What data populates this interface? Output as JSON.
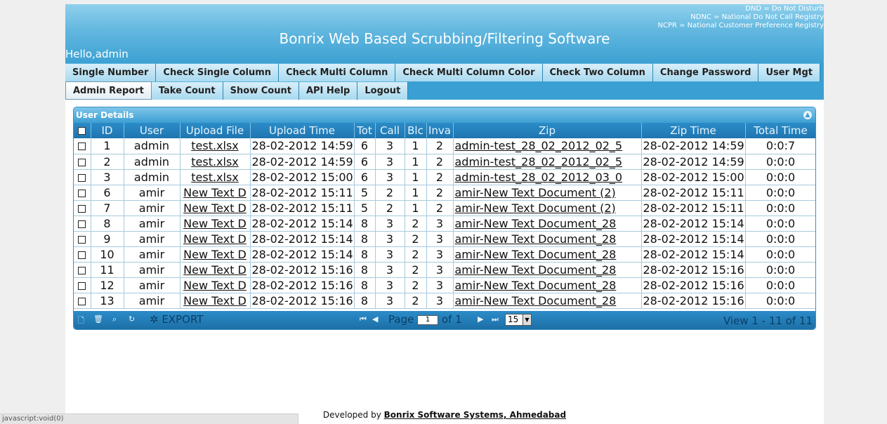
{
  "header": {
    "legend": [
      "DND = Do Not Disturb",
      "NDNC = National Do Not Call Registry",
      "NCPR = National Customer Preference Registry"
    ],
    "title": "Bonrix Web Based Scrubbing/Filtering Software",
    "greeting": "Hello,admin"
  },
  "nav": {
    "row1": [
      "Single Number",
      "Check Single Column",
      "Check Multi Column",
      "Check Multi Column Color",
      "Check Two Column",
      "Change Password",
      "User Mgt"
    ],
    "row2": [
      "Admin Report",
      "Take Count",
      "Show Count",
      "API Help",
      "Logout"
    ]
  },
  "grid": {
    "caption": "User Details",
    "columns": [
      "ID",
      "User",
      "Upload File",
      "Upload Time",
      "Tot",
      "Call",
      "Blc",
      "Inva",
      "Zip",
      "Zip Time",
      "Total Time"
    ],
    "rows": [
      [
        "1",
        "admin",
        "test.xlsx",
        "28-02-2012 14:59",
        "6",
        "3",
        "1",
        "2",
        "admin-test_28_02_2012_02_5",
        "28-02-2012 14:59",
        "0:0:7"
      ],
      [
        "2",
        "admin",
        "test.xlsx",
        "28-02-2012 14:59",
        "6",
        "3",
        "1",
        "2",
        "admin-test_28_02_2012_02_5",
        "28-02-2012 14:59",
        "0:0:0"
      ],
      [
        "3",
        "admin",
        "test.xlsx",
        "28-02-2012 15:00",
        "6",
        "3",
        "1",
        "2",
        "admin-test_28_02_2012_03_0",
        "28-02-2012 15:00",
        "0:0:0"
      ],
      [
        "6",
        "amir",
        "New Text D",
        "28-02-2012 15:11",
        "5",
        "2",
        "1",
        "2",
        "amir-New Text Document (2)",
        "28-02-2012 15:11",
        "0:0:0"
      ],
      [
        "7",
        "amir",
        "New Text D",
        "28-02-2012 15:11",
        "5",
        "2",
        "1",
        "2",
        "amir-New Text Document (2)",
        "28-02-2012 15:11",
        "0:0:0"
      ],
      [
        "8",
        "amir",
        "New Text D",
        "28-02-2012 15:14",
        "8",
        "3",
        "2",
        "3",
        "amir-New Text Document_28",
        "28-02-2012 15:14",
        "0:0:0"
      ],
      [
        "9",
        "amir",
        "New Text D",
        "28-02-2012 15:14",
        "8",
        "3",
        "2",
        "3",
        "amir-New Text Document_28",
        "28-02-2012 15:14",
        "0:0:0"
      ],
      [
        "10",
        "amir",
        "New Text D",
        "28-02-2012 15:14",
        "8",
        "3",
        "2",
        "3",
        "amir-New Text Document_28",
        "28-02-2012 15:14",
        "0:0:0"
      ],
      [
        "11",
        "amir",
        "New Text D",
        "28-02-2012 15:16",
        "8",
        "3",
        "2",
        "3",
        "amir-New Text Document_28",
        "28-02-2012 15:16",
        "0:0:0"
      ],
      [
        "12",
        "amir",
        "New Text D",
        "28-02-2012 15:16",
        "8",
        "3",
        "2",
        "3",
        "amir-New Text Document_28",
        "28-02-2012 15:16",
        "0:0:0"
      ],
      [
        "13",
        "amir",
        "New Text D",
        "28-02-2012 15:16",
        "8",
        "3",
        "2",
        "3",
        "amir-New Text Document_28",
        "28-02-2012 15:16",
        "0:0:0"
      ]
    ]
  },
  "pager": {
    "export_label": "EXPORT",
    "page_label": "Page",
    "page_value": "1",
    "of_label": "of 1",
    "rows_per_page": "15",
    "view_info": "View 1 - 11 of 11"
  },
  "footer": {
    "prefix": "Developed by ",
    "company": "Bonrix Software Systems, Ahmedabad"
  },
  "statusbar": "javascript:void(0)",
  "colors": {
    "header_top": "#8fd0ec",
    "header_bottom": "#3da1d3",
    "grid_header": "#2b8cc8"
  }
}
